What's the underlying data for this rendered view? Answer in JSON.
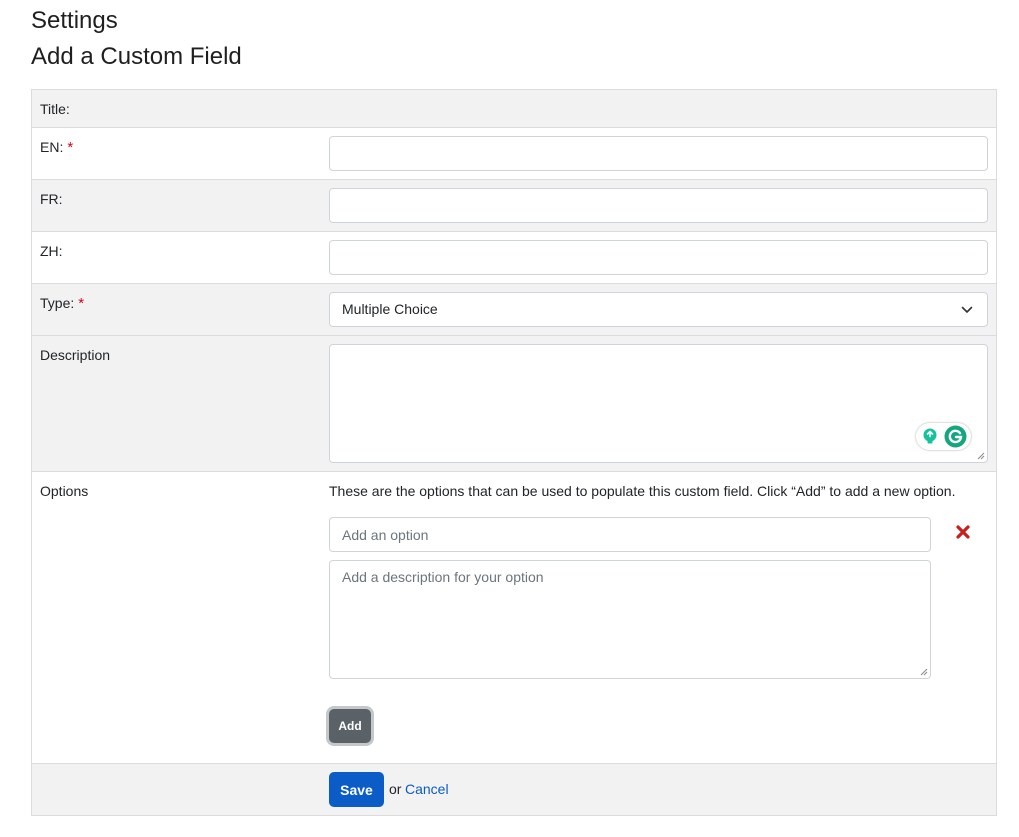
{
  "header": {
    "title": "Settings",
    "subtitle": "Add a Custom Field"
  },
  "form": {
    "title_section_label": "Title:",
    "en_label": "EN:",
    "fr_label": "FR:",
    "zh_label": "ZH:",
    "required_marker": "*",
    "type_label": "Type:",
    "type_value": "Multiple Choice",
    "description_label": "Description",
    "options_label": "Options",
    "options_help": "These are the options that can be used to populate this custom field. Click “Add” to add a new option.",
    "option_name_placeholder": "Add an option",
    "option_description_placeholder": "Add a description for your option",
    "add_button": "Add",
    "save_button": "Save",
    "or_text": "or",
    "cancel_link": "Cancel"
  },
  "colors": {
    "primary": "#0b5cc7",
    "required": "#d0021b",
    "delete": "#c81e1e",
    "secondary_button": "#5a6268",
    "row_shade": "#f2f2f2",
    "grammarly_green": "#15c39a"
  },
  "icons": {
    "delete": "delete-x-icon",
    "select_chevron": "chevron-down-icon",
    "grammarly_bulb": "lightbulb-icon",
    "grammarly_logo": "grammarly-g-icon"
  }
}
